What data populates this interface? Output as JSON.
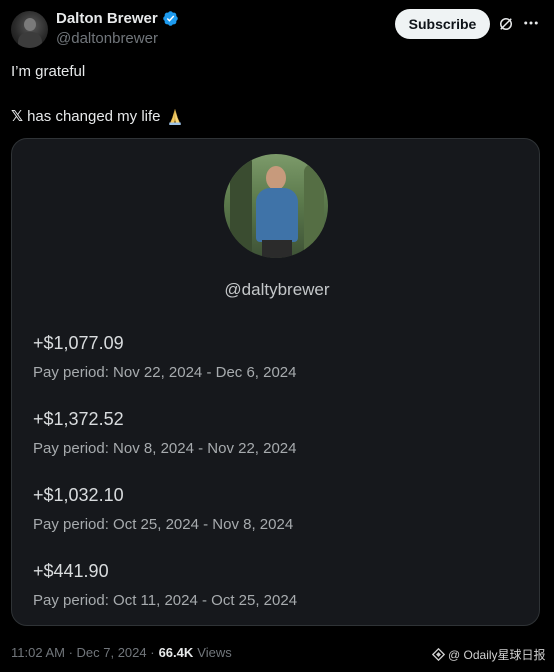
{
  "author": {
    "display_name": "Dalton Brewer",
    "handle": "@daltonbrewer"
  },
  "header": {
    "subscribe_label": "Subscribe"
  },
  "post": {
    "line1": "I’m grateful",
    "x_logo": "𝕏",
    "line2": "has changed my life"
  },
  "card": {
    "handle": "@daltybrewer",
    "payouts": [
      {
        "amount": "+$1,077.09",
        "period": "Pay period: Nov 22, 2024 - Dec 6, 2024"
      },
      {
        "amount": "+$1,372.52",
        "period": "Pay period: Nov 8, 2024 - Nov 22, 2024"
      },
      {
        "amount": "+$1,032.10",
        "period": "Pay period: Oct 25, 2024 - Nov 8, 2024"
      },
      {
        "amount": "+$441.90",
        "period": "Pay period: Oct 11, 2024 - Oct 25, 2024"
      }
    ]
  },
  "footer": {
    "timestamp": "11:02 AM · Dec 7, 2024 ·",
    "views_count": "66.4K",
    "views_label": "Views"
  },
  "watermark": {
    "text": "@ Odaily星球日报"
  },
  "icons": {
    "verified": "verified-badge-icon",
    "grok": "grok-icon",
    "more": "more-icon",
    "emoji": "folded-hands-emoji-icon"
  },
  "colors": {
    "background": "#000000",
    "card_background": "#16181c",
    "verified_blue": "#1d9bf0",
    "subscribe_bg": "#eff3f4",
    "muted_text": "#71767b"
  }
}
